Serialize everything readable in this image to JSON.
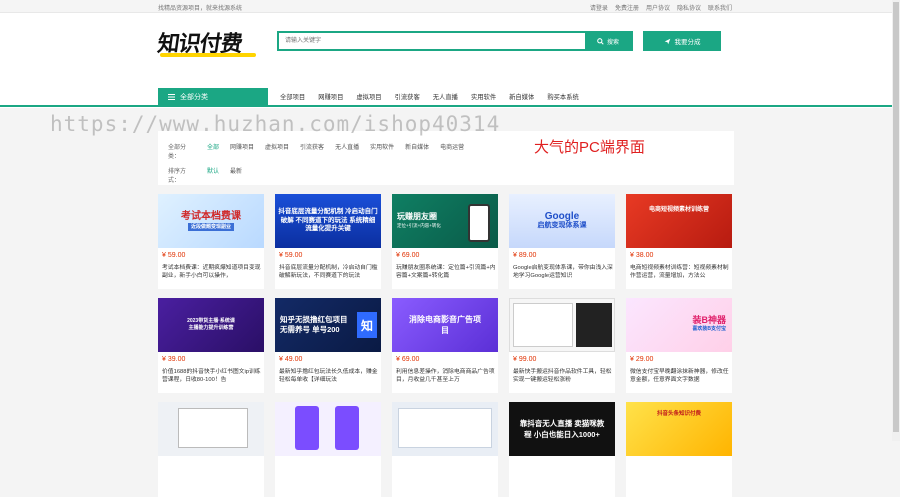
{
  "topbar": {
    "left_text": "找精品资源项目，就来找源系统",
    "links": [
      "请登录",
      "免费注册",
      "用户协议",
      "隐私协议",
      "联系我们"
    ]
  },
  "header": {
    "logo_text": "知识付费",
    "search_placeholder": "请输入关键字",
    "search_button": "搜索",
    "publish_button": "我要分成"
  },
  "nav": {
    "category_button": "全部分类",
    "items": [
      "全部项目",
      "网赚项目",
      "虚拟项目",
      "引流获客",
      "无人直播",
      "实用软件",
      "新自媒体",
      "购买本系统"
    ]
  },
  "watermark": "https://www.huzhan.com/ishop40314",
  "promo_text": "大气的PC端界面",
  "filter": {
    "row1_label": "全部分类：",
    "row1_items": [
      "全部",
      "网赚项目",
      "虚拟项目",
      "引流获客",
      "无人直播",
      "实用软件",
      "新自媒体",
      "电商运营"
    ],
    "row2_label": "排序方式：",
    "row2_items": [
      "默认",
      "最新"
    ]
  },
  "colors": {
    "accent": "#1ba784",
    "price": "#e03000",
    "promo": "#e02020"
  },
  "cards": [
    {
      "price": "¥ 59.00",
      "title": "考试本档费课：近期疯爆知道项目变现副业，新手小白可以操作，",
      "thumb": "考试本档费课",
      "thumb_sub": "近段做题变现副业"
    },
    {
      "price": "¥ 59.00",
      "title": "抖音底层流量分配机制，冷启动自门槛破解新玩法，不同赛道下的玩法",
      "thumb": "抖音底层流量分配机制 冷启动自门破解 不同赛道下的玩法 系统精细流量化提升关键",
      "thumb_sub": ""
    },
    {
      "price": "¥ 69.00",
      "title": "玩赚朋友圈系统课：定位篇+引流篇+内容篇+文案篇+转化篇",
      "thumb": "玩赚朋友圈",
      "thumb_sub": "定位+引流+内容+转化"
    },
    {
      "price": "¥ 89.00",
      "title": "Google启航变现体系课，带你由浅入深地学习Google运营知识",
      "thumb": "Google",
      "thumb_sub": "启航变现体系课"
    },
    {
      "price": "¥ 38.00",
      "title": "电商短视频素材训练营：短视频素材制作营运营，流量增加，方法公",
      "thumb": "电商短视频素材训练营",
      "thumb_sub": ""
    },
    {
      "price": "¥ 39.00",
      "title": "价值1688的抖音快手小红书图文ip训练营课程，日收80-100！告",
      "thumb": "2023带货主播·系统课",
      "thumb_sub": "主播能力提升训练营"
    },
    {
      "price": "¥ 49.00",
      "title": "最新知乎撸红包玩法长久低成本，赚金轻松每单收【详细玩法",
      "thumb": "知乎无损撸红包项目 无需养号 单号200",
      "thumb_sub": ""
    },
    {
      "price": "¥ 69.00",
      "title": "利用信息差操作，消除电商商品广告项目，月收益几千甚至上万",
      "thumb": "消除电商影音广告项目",
      "thumb_sub": ""
    },
    {
      "price": "¥ 99.00",
      "title": "最新快手搬运抖音作品软件工具，轻松实现一键搬运轻松涨粉",
      "thumb": "",
      "thumb_sub": ""
    },
    {
      "price": "¥ 29.00",
      "title": "微信支付宝早晚翻涂抹新神器，修改任意金额，任意界面文字数据",
      "thumb": "装B神器",
      "thumb_sub": "喜欢装B支付宝"
    },
    {
      "price": "",
      "title": "",
      "thumb": "",
      "thumb_sub": ""
    },
    {
      "price": "",
      "title": "",
      "thumb": "",
      "thumb_sub": ""
    },
    {
      "price": "",
      "title": "",
      "thumb": "",
      "thumb_sub": ""
    },
    {
      "price": "",
      "title": "",
      "thumb": "靠抖音无人直播 卖猫咪教程 小白也能日入1000+",
      "thumb_sub": ""
    },
    {
      "price": "",
      "title": "",
      "thumb": "抖音头条知识付费",
      "thumb_sub": ""
    }
  ]
}
